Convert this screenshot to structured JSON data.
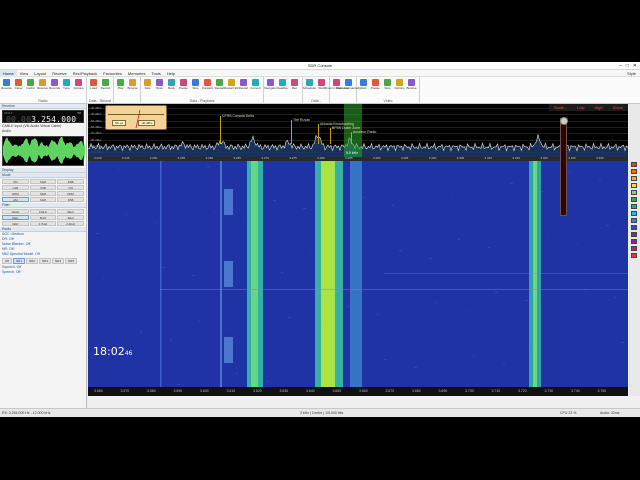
{
  "window": {
    "title": "SDR Console",
    "minimize": "–",
    "maximize": "□",
    "close": "✕"
  },
  "menu": {
    "items": [
      "Home",
      "View",
      "Layout",
      "Receive",
      "Rec/Playback",
      "Favourites",
      "Memories",
      "Tools",
      "Help"
    ],
    "active": 0,
    "style": "Style"
  },
  "ribbon": {
    "groups": [
      {
        "label": "Radio",
        "buttons": [
          "Receive",
          "Close",
          "Cache",
          "Receive",
          "Records",
          "Tune",
          "Options"
        ]
      },
      {
        "label": "Data - Record",
        "buttons": [
          "Load",
          "Record"
        ]
      },
      {
        "label": "",
        "buttons": [
          "Play",
          "Browse"
        ]
      },
      {
        "label": "Data - Playback",
        "buttons": [
          "Fast",
          "Open",
          "Back",
          "Pause",
          "Stop",
          "Forward",
          "Restart",
          "Restart EC",
          "Restart",
          "Convert"
        ]
      },
      {
        "label": "",
        "buttons": [
          "Navigator",
          "Satellite",
          "Rec"
        ]
      },
      {
        "label": "Data - Scheduler",
        "buttons": [
          "Scheduler",
          "Start"
        ]
      },
      {
        "label": "",
        "buttons": [
          "Show in status bar",
          "Start automatically"
        ]
      },
      {
        "label": "Video",
        "buttons": [
          "Start",
          "Pause",
          "Stop",
          "Options",
          "Browse"
        ]
      }
    ]
  },
  "left": {
    "receiver_title": "Receive",
    "vfo": "VFO 1",
    "freq_dim": "00.00",
    "freq_main": "3.254.000",
    "tr_label": "TX",
    "input_label": "CABLE Input (VB-Audio Virtual Cable)",
    "audio_label": "Audio",
    "display_title": "Display",
    "mode_title": "Mode",
    "mode_buttons": [
      "AM",
      "SAM",
      "DSB",
      "LSB",
      "USB",
      "CW",
      "WFM",
      "NFM",
      "DRM",
      "AM",
      "SAM",
      "DSB"
    ],
    "mode_selected": 9,
    "filter_title": "Filter",
    "filter_buttons": [
      "12kHz",
      "10kHz",
      "8kHz",
      "6kHz",
      "5kHz",
      "4kHz",
      "3kHz",
      "2.7kHz",
      "2.4kHz"
    ],
    "filter_selected": 3,
    "radio_title": "Radio",
    "links": [
      "AGC: Medium",
      "DR: Off",
      "Noise Blanker: Off",
      "NR: Off",
      "NB2 Spectral Model: Off"
    ],
    "nr_buttons": [
      "Off",
      "NR1",
      "NR2",
      "NR3",
      "NR4",
      "NR5"
    ],
    "nr_selected": 1,
    "squelch": "Squelch: Off",
    "speech": "Speech: Off"
  },
  "spectrum": {
    "controls": [
      "Scale...",
      "Low",
      "High",
      "Zoom"
    ],
    "db_labels": [
      "-30 dBm",
      "-40 dBm",
      "-50 dBm",
      "-60 dBm",
      "-70 dBm",
      "-80 dBm",
      "-90 dBm",
      "-100 dBm"
    ],
    "meter_left": "S9 +2",
    "meter_right": "-40 dBm",
    "markers": [
      {
        "label": "CFRB Canada Delta",
        "x_frac": 0.244
      },
      {
        "label": "The Ruvan",
        "x_frac": 0.375
      },
      {
        "label": "Akkadia Broadcasting",
        "x_frac": 0.425
      },
      {
        "label": "BFBS Dutch Zone",
        "x_frac": 0.448
      },
      {
        "label": "Amateur Radio",
        "x_frac": 0.487
      }
    ],
    "center_label": "5.0 kHz"
  },
  "freq_axis": [
    "3.240",
    "3.245",
    "3.250",
    "3.255",
    "3.260",
    "3.265",
    "3.270",
    "3.275",
    "3.280",
    "3.285",
    "3.290",
    "3.295",
    "3.300",
    "3.305",
    "3.310",
    "3.315",
    "3.320",
    "3.325",
    "3.330"
  ],
  "bottom_axis": [
    "3.560",
    "3.570",
    "3.580",
    "3.590",
    "3.600",
    "3.610",
    "3.620",
    "3.630",
    "3.640",
    "3.650",
    "3.660",
    "3.670",
    "3.680",
    "3.690",
    "3.700",
    "3.710",
    "3.720",
    "3.730",
    "3.740",
    "3.750"
  ],
  "clock": {
    "hm": "18:02",
    "sec": "46"
  },
  "status": {
    "left": "RX: 3.254.000 Hz - 12.000 kHz",
    "middle": "3 kHz  |  Centre  |  1/5,000 bits",
    "right": "CPU 23 %",
    "audio": "Audio: 32ms"
  },
  "colors": {
    "accent": "#ff4d4d",
    "waterfall_bg": "#1f33a5"
  }
}
